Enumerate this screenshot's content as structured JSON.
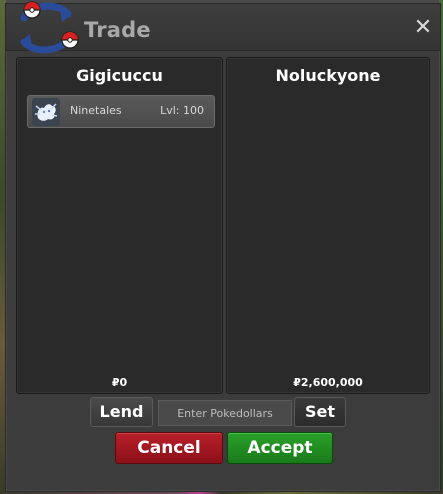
{
  "window": {
    "title": "Trade",
    "close_label": "✕"
  },
  "left_trader": {
    "name": "Gigicuccu",
    "money": "₽0",
    "pokemon": [
      {
        "name": "Ninetales",
        "level": "Lvl: 100",
        "icon": "ninetales-icon"
      }
    ]
  },
  "right_trader": {
    "name": "Noluckyone",
    "money": "₽2,600,000",
    "pokemon": []
  },
  "controls": {
    "lend_label": "Lend",
    "money_placeholder": "Enter Pokedollars",
    "set_label": "Set",
    "cancel_label": "Cancel",
    "accept_label": "Accept"
  },
  "colors": {
    "cancel": "#a8141e",
    "accept": "#229022",
    "panel_bg": "#2a2a2a"
  }
}
